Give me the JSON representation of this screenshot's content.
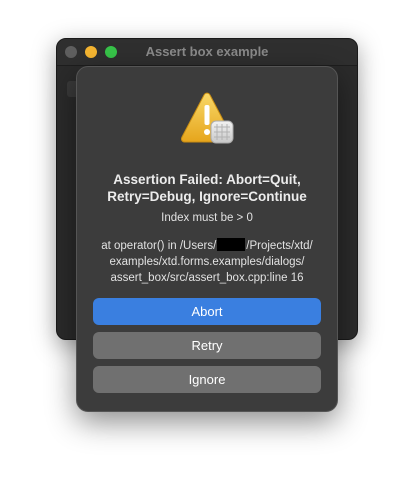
{
  "parent_window": {
    "title": "Assert box example"
  },
  "alert": {
    "icon": "warning-triangle-app-icon",
    "title": "Assertion Failed: Abort=Quit, Retry=Debug, Ignore=Continue",
    "message": "Index must be > 0",
    "detail": {
      "prefix": "at operator() in /Users/",
      "line2_suffix": "/Projects/xtd/",
      "line3": "examples/xtd.forms.examples/dialogs/",
      "line4": "assert_box/src/assert_box.cpp:line 16"
    },
    "buttons": {
      "abort": "Abort",
      "retry": "Retry",
      "ignore": "Ignore"
    }
  },
  "colors": {
    "accent": "#3a7fe0",
    "secondary_button": "#707070",
    "alert_background": "#3c3c3c"
  }
}
